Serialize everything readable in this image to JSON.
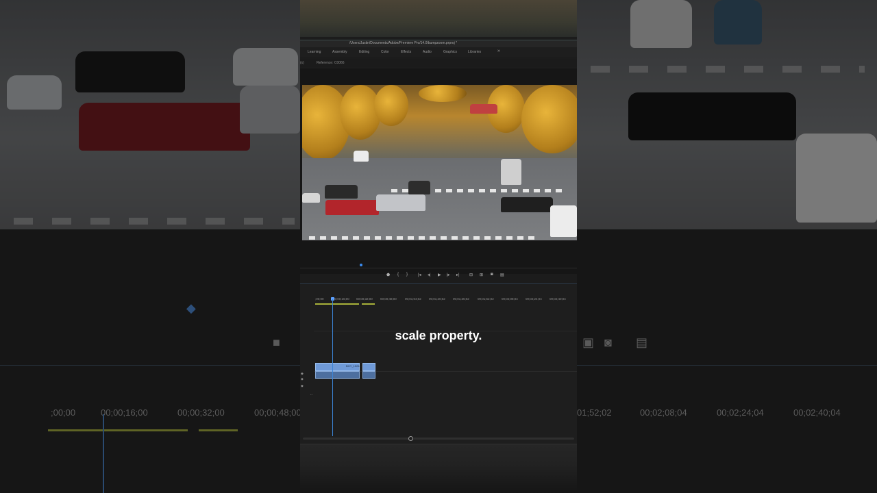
{
  "caption": "scale property.",
  "window": {
    "title_path": "/Users/Justin/Documents/Adobe/Premiere Pro/14.0/bumpzoom.prproj *"
  },
  "workspaces": [
    "Learning",
    "Assembly",
    "Editing",
    "Color",
    "Effects",
    "Audio",
    "Graphics",
    "Libraries"
  ],
  "workspaces_more": "»",
  "source_bar": {
    "left": "(x)",
    "reference": "Reference: C0066"
  },
  "timeline": {
    "timecodes": [
      ";00;00",
      "00;00;16;00",
      "00;00;32;00",
      "00;00;48;00",
      "00;01;04;02",
      "00;01;20;02",
      "00;01;36;02",
      "00;01;52;02",
      "00;02;08;04",
      "00;02;24;04",
      "00;02;40;04"
    ],
    "clip_name": "BGY_1024..."
  },
  "background": {
    "left_timecodes": [
      ";00;00",
      "00;00;16;00",
      "00;00;32;00",
      "00;00;48;00"
    ],
    "right_timecodes": [
      "01;52;02",
      "00;02;08;04",
      "00;02;24;04",
      "00;02;40;04"
    ]
  },
  "colors": {
    "accent_blue": "#3b8cf0",
    "work_area_yellow": "#a8b23a",
    "clip_blue": "#6f9ad8"
  },
  "icons": [
    "marker-icon",
    "in-point-icon",
    "out-point-icon",
    "go-to-in-icon",
    "step-back-icon",
    "play-icon",
    "step-forward-icon",
    "go-to-out-icon",
    "insert-icon",
    "overwrite-icon",
    "export-frame-icon",
    "button-editor-icon"
  ]
}
